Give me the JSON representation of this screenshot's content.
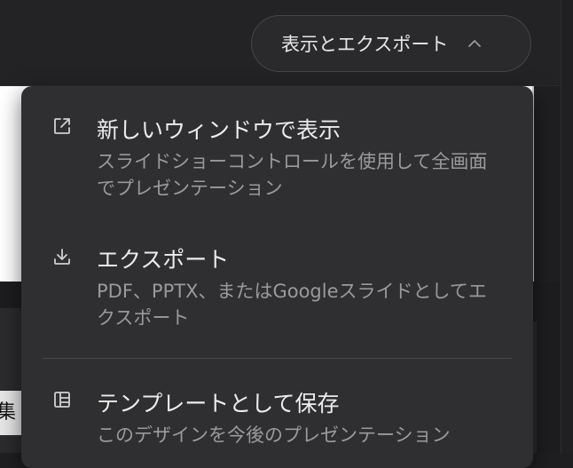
{
  "header": {
    "view_export_label": "表示とエクスポート",
    "chevron_icon": "chevron-up-icon"
  },
  "background": {
    "partial_label": "集"
  },
  "menu": {
    "items": [
      {
        "icon": "external-link-icon",
        "title": "新しいウィンドウで表示",
        "description": "スライドショーコントロールを使用して全画面でプレゼンテーション"
      },
      {
        "icon": "download-icon",
        "title": "エクスポート",
        "description": "PDF、PPTX、またはGoogleスライドとしてエクスポート"
      },
      {
        "icon": "template-icon",
        "title": "テンプレートとして保存",
        "description": "このデザインを今後のプレゼンテーション"
      }
    ]
  }
}
